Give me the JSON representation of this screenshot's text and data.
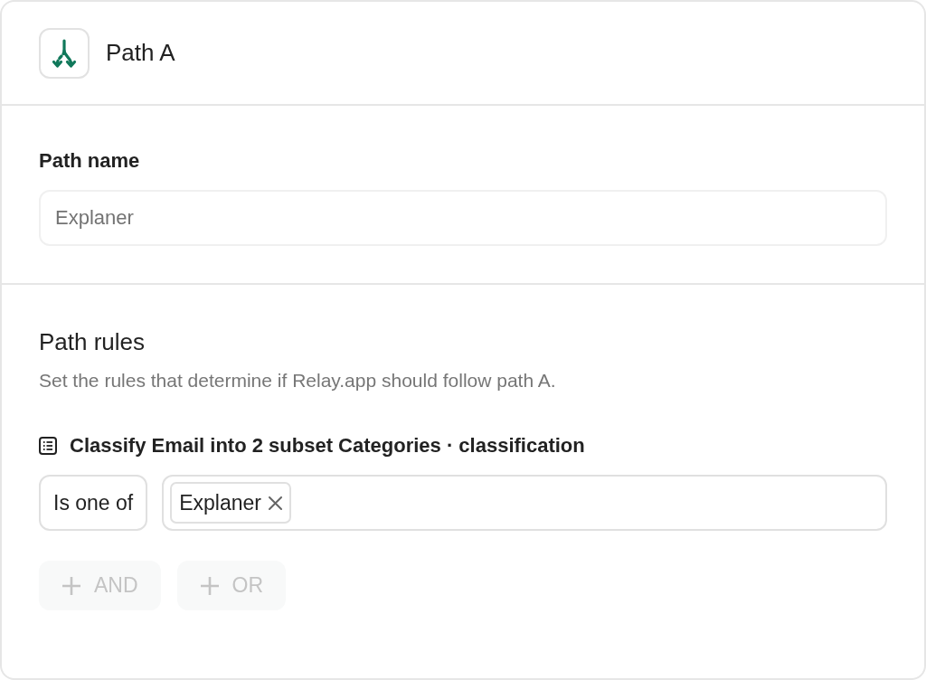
{
  "header": {
    "title": "Path A"
  },
  "path_name": {
    "label": "Path name",
    "placeholder": "Explaner"
  },
  "path_rules": {
    "title": "Path rules",
    "description": "Set the rules that determine if Relay.app should follow path A.",
    "rules": [
      {
        "source": "Classify Email into 2 subset Categories · classification",
        "operator": "Is one of",
        "values": [
          {
            "label": "Explaner"
          }
        ]
      }
    ],
    "buttons": [
      {
        "label": "AND",
        "disabled": true
      },
      {
        "label": "OR",
        "disabled": true
      }
    ]
  }
}
